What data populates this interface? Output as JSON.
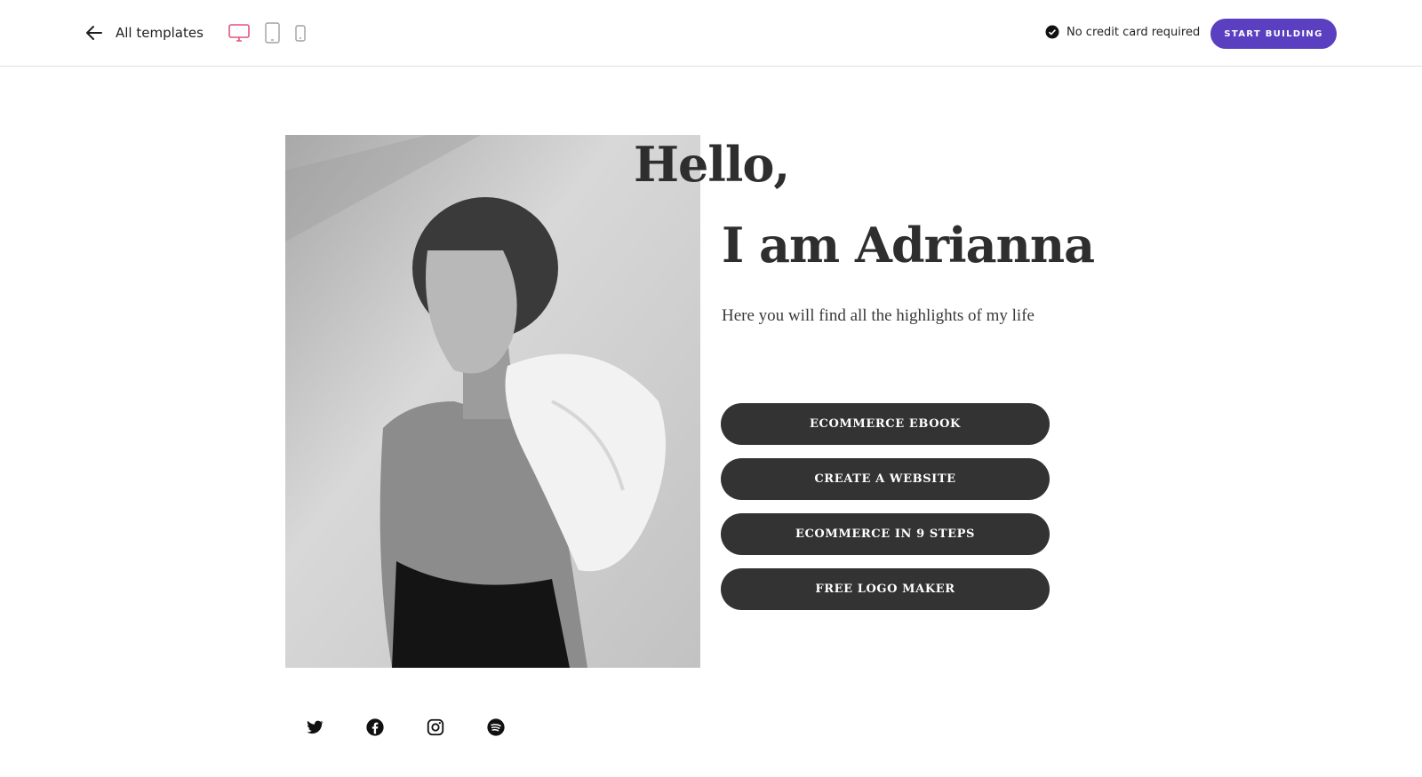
{
  "topbar": {
    "back_label": "All templates",
    "devices": [
      "desktop-icon",
      "tablet-icon",
      "mobile-icon"
    ],
    "active_device": "desktop",
    "notice": "No credit card required",
    "cta_label": "START BUILDING"
  },
  "hero": {
    "greeting": "Hello,",
    "name_line": "I am Adrianna",
    "subtitle": "Here you will find all the highlights of my life",
    "buttons": [
      {
        "label": "ECOMMERCE EBOOK"
      },
      {
        "label": "CREATE A WEBSITE"
      },
      {
        "label": "ECOMMERCE IN 9 STEPS"
      },
      {
        "label": "FREE LOGO MAKER"
      }
    ],
    "photo_icon": "portrait-photo"
  },
  "social": [
    "twitter-icon",
    "facebook-icon",
    "instagram-icon",
    "spotify-icon"
  ],
  "colors": {
    "accent": "#5a3fc0",
    "device_active": "#e0577d",
    "button_dark": "#333333",
    "text_dark": "#2e2e2e"
  }
}
